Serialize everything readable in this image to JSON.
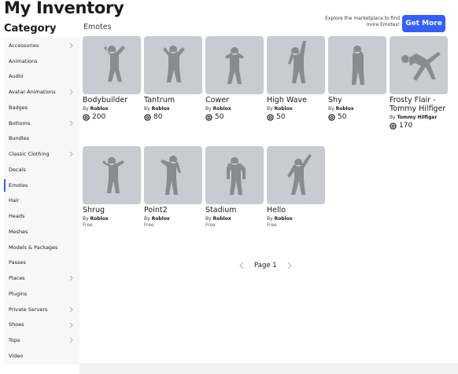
{
  "header": {
    "title": "My Inventory",
    "category_heading": "Category",
    "section_label": "Emotes",
    "promo_text": "Explore the marketplace to find more Emotes!",
    "get_more_label": "Get More"
  },
  "colors": {
    "accent": "#335fff",
    "thumb_bg": "#c9cbd3",
    "figure": "#8a8b8e"
  },
  "sidebar": {
    "items": [
      {
        "label": "Accessories",
        "has_submenu": true
      },
      {
        "label": "Animations",
        "has_submenu": false
      },
      {
        "label": "Audio",
        "has_submenu": false
      },
      {
        "label": "Avatar Animations",
        "has_submenu": true
      },
      {
        "label": "Badges",
        "has_submenu": false
      },
      {
        "label": "Bottoms",
        "has_submenu": true
      },
      {
        "label": "Bundles",
        "has_submenu": false
      },
      {
        "label": "Classic Clothing",
        "has_submenu": true
      },
      {
        "label": "Decals",
        "has_submenu": false
      },
      {
        "label": "Emotes",
        "has_submenu": false,
        "active": true
      },
      {
        "label": "Hair",
        "has_submenu": false
      },
      {
        "label": "Heads",
        "has_submenu": false
      },
      {
        "label": "Meshes",
        "has_submenu": false
      },
      {
        "label": "Models & Packages",
        "has_submenu": false
      },
      {
        "label": "Passes",
        "has_submenu": false
      },
      {
        "label": "Places",
        "has_submenu": true
      },
      {
        "label": "Plugins",
        "has_submenu": false
      },
      {
        "label": "Private Servers",
        "has_submenu": true
      },
      {
        "label": "Shoes",
        "has_submenu": true
      },
      {
        "label": "Tops",
        "has_submenu": true
      },
      {
        "label": "Video",
        "has_submenu": false
      }
    ]
  },
  "items": [
    {
      "name": "Bodybuilder",
      "by": "By",
      "creator": "Roblox",
      "price": "200"
    },
    {
      "name": "Tantrum",
      "by": "By",
      "creator": "Roblox",
      "price": "80"
    },
    {
      "name": "Cower",
      "by": "By",
      "creator": "Roblox",
      "price": "50"
    },
    {
      "name": "High Wave",
      "by": "By",
      "creator": "Roblox",
      "price": "50"
    },
    {
      "name": "Shy",
      "by": "By",
      "creator": "Roblox",
      "price": "50"
    },
    {
      "name": "Frosty Flair - Tommy Hilfiger",
      "by": "By",
      "creator": "Tommy Hilfiger",
      "price": "170"
    },
    {
      "name": "Shrug",
      "by": "By",
      "creator": "Roblox",
      "price": "Free"
    },
    {
      "name": "Point2",
      "by": "By",
      "creator": "Roblox",
      "price": "Free"
    },
    {
      "name": "Stadium",
      "by": "By",
      "creator": "Roblox",
      "price": "Free"
    },
    {
      "name": "Hello",
      "by": "By",
      "creator": "Roblox",
      "price": "Free"
    }
  ],
  "pager": {
    "label": "Page 1"
  }
}
